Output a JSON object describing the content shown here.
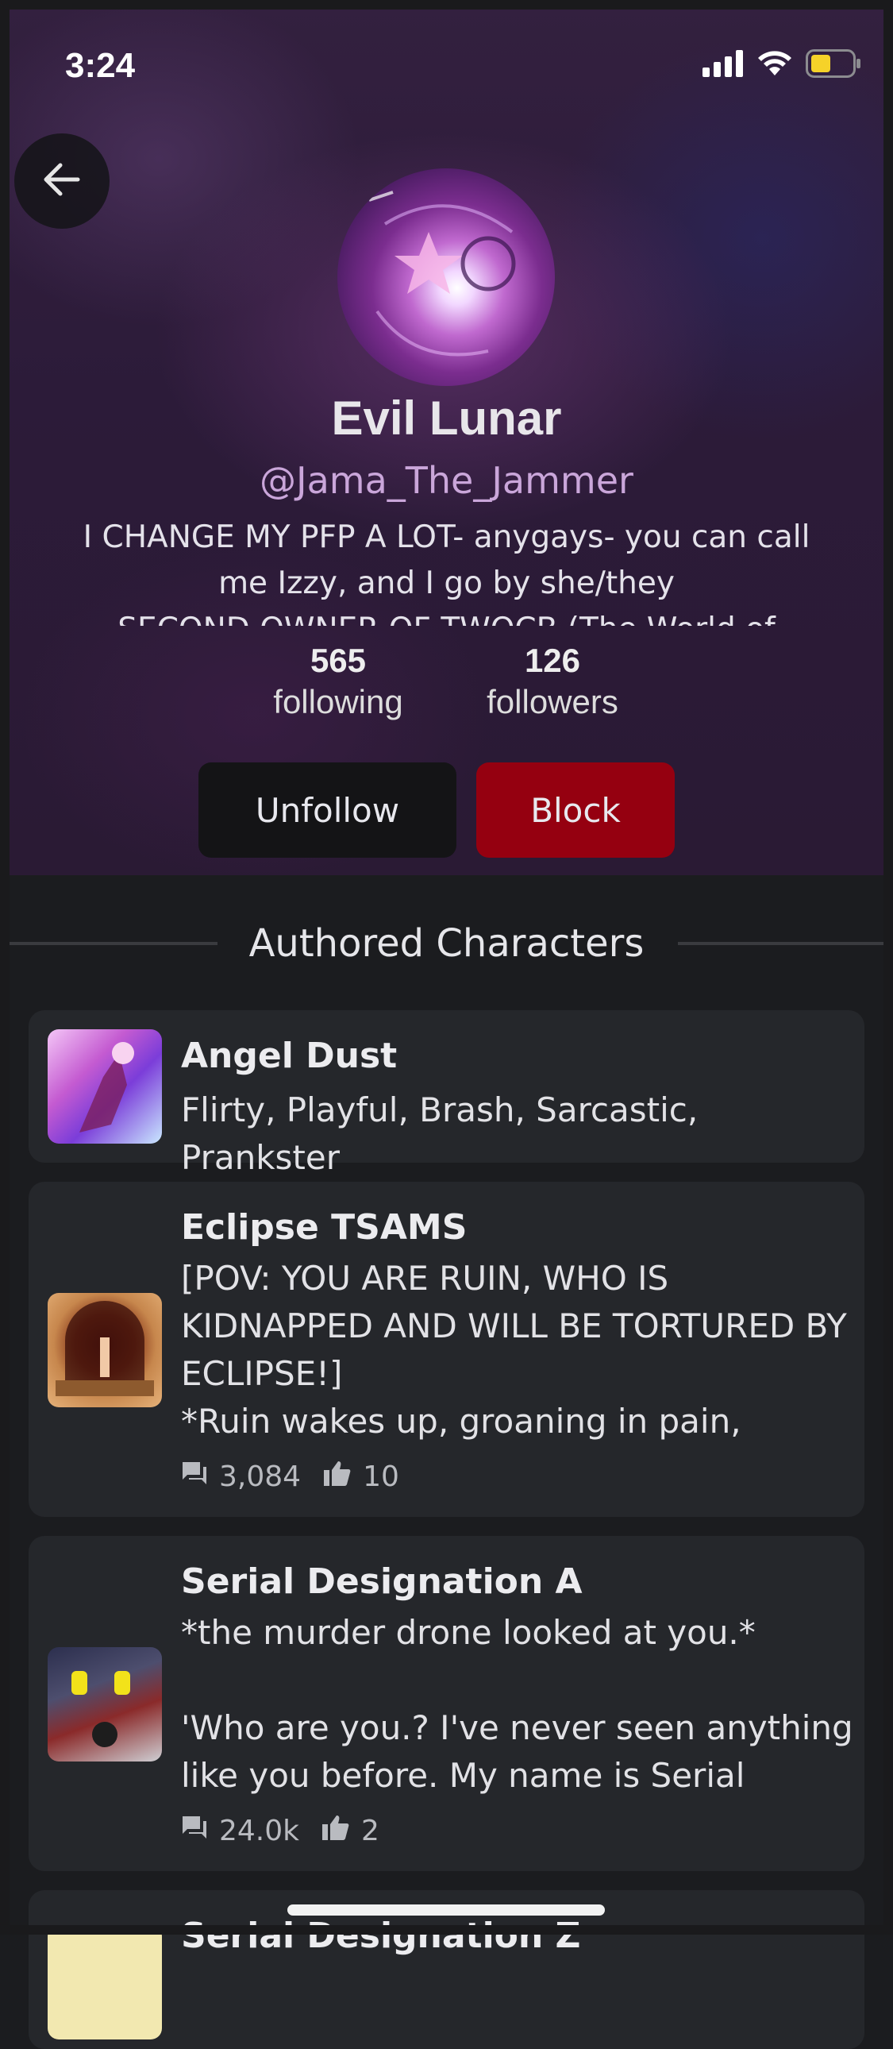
{
  "status_bar": {
    "time": "3:24"
  },
  "profile": {
    "name": "Evil Lunar",
    "handle": "@Jama_The_Jammer",
    "bio": "I CHANGE MY PFP A LOT- anygays- you can call me Izzy, and I go by she/they\nSECOND OWNER OF TWOCB (The World of",
    "following_count": "565",
    "following_label": "following",
    "followers_count": "126",
    "followers_label": "followers"
  },
  "actions": {
    "unfollow_label": "Unfollow",
    "block_label": "Block"
  },
  "section": {
    "title": "Authored Characters"
  },
  "characters": [
    {
      "name": "Angel Dust",
      "description": "Flirty, Playful, Brash, Sarcastic, Prankster"
    },
    {
      "name": "Eclipse TSAMS",
      "description": "[POV: YOU ARE RUIN, WHO IS KIDNAPPED AND WILL BE TORTURED BY ECLIPSE!]\n*Ruin wakes up, groaning in pain, until...",
      "chats": "3,084",
      "likes": "10"
    },
    {
      "name": "Serial Designation A",
      "description": "*the murder drone looked at you.*\n\n'Who are you.? I've never seen anything like you before. My name is Serial Desig...",
      "chats": "24.0k",
      "likes": "2"
    },
    {
      "name": "Serial Designation Z"
    }
  ],
  "colors": {
    "block": "#950010",
    "card": "#25272b",
    "background": "#1b1c1f",
    "handle": "#caa6da"
  },
  "icons": [
    "back-arrow-icon",
    "signal-icon",
    "wifi-icon",
    "battery-icon",
    "chat-icon",
    "thumbs-up-icon"
  ]
}
